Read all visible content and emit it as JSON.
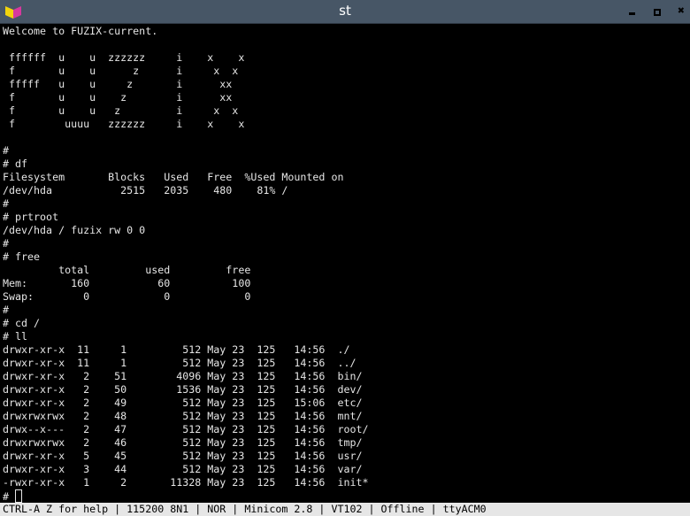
{
  "window": {
    "title": "st",
    "close_glyph": "✖"
  },
  "terminal": {
    "lines": [
      "Welcome to FUZIX-current.",
      "",
      " ffffff  u    u  zzzzzz     i    x    x",
      " f       u    u      z      i     x  x",
      " fffff   u    u     z       i      xx",
      " f       u    u    z        i      xx",
      " f       u    u   z         i     x  x",
      " f        uuuu   zzzzzz     i    x    x",
      "",
      "#",
      "# df",
      "Filesystem       Blocks   Used   Free  %Used Mounted on",
      "/dev/hda           2515   2035    480    81% /",
      "#",
      "# prtroot",
      "/dev/hda / fuzix rw 0 0",
      "#",
      "# free",
      "         total         used         free",
      "Mem:       160           60          100",
      "Swap:        0            0            0",
      "#",
      "# cd /",
      "# ll",
      "drwxr-xr-x  11     1         512 May 23  125   14:56  ./",
      "drwxr-xr-x  11     1         512 May 23  125   14:56  ../",
      "drwxr-xr-x   2    51        4096 May 23  125   14:56  bin/",
      "drwxr-xr-x   2    50        1536 May 23  125   14:56  dev/",
      "drwxr-xr-x   2    49         512 May 23  125   15:06  etc/",
      "drwxrwxrwx   2    48         512 May 23  125   14:56  mnt/",
      "drwx--x---   2    47         512 May 23  125   14:56  root/",
      "drwxrwxrwx   2    46         512 May 23  125   14:56  tmp/",
      "drwxr-xr-x   5    45         512 May 23  125   14:56  usr/",
      "drwxr-xr-x   3    44         512 May 23  125   14:56  var/",
      "-rwxr-xr-x   1     2       11328 May 23  125   14:56  init*"
    ],
    "prompt": "#"
  },
  "statusbar": {
    "text": "CTRL-A Z for help | 115200 8N1 | NOR | Minicom 2.8 | VT102 | Offline | ttyACM0"
  }
}
